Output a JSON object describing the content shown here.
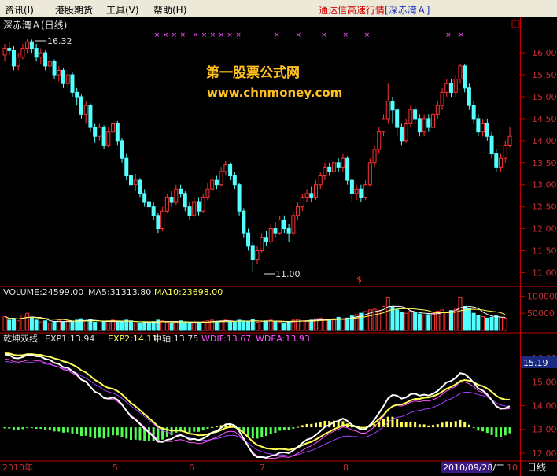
{
  "menu": [
    {
      "label": "资讯(I)"
    },
    {
      "label": "港股期货"
    },
    {
      "label": "工具(V)"
    },
    {
      "label": "帮助(H)"
    }
  ],
  "app_title": {
    "name": "通达信高速行情",
    "stock": "[深赤湾Ａ]"
  },
  "main_panel": {
    "title": "深赤湾Ａ(日线)",
    "watermark_line1": "第一股票公式网",
    "watermark_line2": "www.chnmoney.com",
    "high_label": "16.32",
    "low_label": "11.00",
    "signal_mark": "$"
  },
  "volume_panel": {
    "volume": "VOLUME:24599.00",
    "ma5": "MA5:31313.80",
    "ma10": "MA10:23698.00"
  },
  "indicator_panel": {
    "name": "乾坤双线",
    "exp1": "EXP1:13.94",
    "exp2": "EXP2:14.11",
    "mid": "中轴:13.75",
    "wdif": "WDIF:13.67",
    "wdea": "WDEA:13.93",
    "current_value": "15.19"
  },
  "axes": {
    "price_ticks": [
      "16.00",
      "15.50",
      "15.00",
      "14.50",
      "14.00",
      "13.50",
      "13.00",
      "12.50",
      "12.00",
      "11.50",
      "11.00"
    ],
    "volume_ticks": [
      "100000",
      "50000"
    ],
    "indicator_ticks": [
      "16.00",
      "15.00",
      "14.00",
      "13.00",
      "12.00"
    ],
    "x_labels": [
      "2010年",
      "5",
      "6",
      "7",
      "8"
    ],
    "cursor_date": "2010/09/28/二",
    "x_last": "10",
    "period": "日线"
  },
  "colors": {
    "up": "#ff3232",
    "down": "#54ffff",
    "exp1": "#ffff54",
    "exp2": "#ffffff",
    "wdif": "#ff54ff",
    "wdea": "#a040ff",
    "hist_up": "#ffff54",
    "hist_down": "#54ff54",
    "axis": "#c00000"
  },
  "chart_data": {
    "type": "candlestick",
    "price_range": [
      10.9,
      16.45
    ],
    "candles": [
      [
        15.95,
        16.1,
        16.2,
        15.8
      ],
      [
        16.1,
        16.05,
        16.25,
        15.95
      ],
      [
        16.05,
        15.7,
        16.15,
        15.6
      ],
      [
        15.7,
        15.9,
        16.0,
        15.6
      ],
      [
        15.9,
        16.1,
        16.2,
        15.85
      ],
      [
        16.1,
        16.25,
        16.32,
        16.0
      ],
      [
        16.25,
        16.1,
        16.3,
        16.0
      ],
      [
        16.1,
        15.9,
        16.2,
        15.8
      ],
      [
        15.9,
        16.0,
        16.1,
        15.75
      ],
      [
        16.0,
        15.7,
        16.05,
        15.6
      ],
      [
        15.7,
        15.8,
        15.9,
        15.55
      ],
      [
        15.8,
        15.5,
        15.85,
        15.4
      ],
      [
        15.5,
        15.6,
        15.7,
        15.35
      ],
      [
        15.6,
        15.3,
        15.65,
        15.2
      ],
      [
        15.3,
        15.5,
        15.6,
        15.2
      ],
      [
        15.5,
        15.1,
        15.55,
        15.0
      ],
      [
        15.1,
        15.0,
        15.2,
        14.8
      ],
      [
        15.0,
        14.6,
        15.05,
        14.5
      ],
      [
        14.6,
        14.8,
        14.9,
        14.4
      ],
      [
        14.8,
        14.3,
        14.85,
        14.2
      ],
      [
        14.3,
        14.1,
        14.4,
        13.95
      ],
      [
        14.1,
        14.3,
        14.4,
        14.0
      ],
      [
        14.3,
        13.9,
        14.35,
        13.8
      ],
      [
        13.9,
        14.2,
        14.3,
        13.85
      ],
      [
        14.2,
        14.4,
        14.5,
        14.1
      ],
      [
        14.4,
        14.0,
        14.45,
        13.9
      ],
      [
        14.0,
        13.6,
        14.05,
        13.5
      ],
      [
        13.6,
        13.2,
        13.7,
        13.1
      ],
      [
        13.2,
        13.0,
        13.3,
        12.9
      ],
      [
        13.0,
        13.1,
        13.25,
        12.85
      ],
      [
        13.1,
        12.8,
        13.15,
        12.7
      ],
      [
        12.8,
        12.6,
        12.9,
        12.5
      ],
      [
        12.6,
        12.5,
        12.7,
        12.3
      ],
      [
        12.5,
        12.3,
        12.6,
        12.2
      ],
      [
        12.3,
        12.0,
        12.35,
        11.9
      ],
      [
        12.0,
        12.4,
        12.5,
        11.95
      ],
      [
        12.4,
        12.7,
        12.8,
        12.35
      ],
      [
        12.7,
        12.6,
        12.85,
        12.5
      ],
      [
        12.6,
        12.9,
        13.0,
        12.55
      ],
      [
        12.9,
        12.8,
        13.0,
        12.7
      ],
      [
        12.8,
        12.5,
        12.85,
        12.4
      ],
      [
        12.5,
        12.3,
        12.6,
        12.2
      ],
      [
        12.3,
        12.6,
        12.7,
        12.25
      ],
      [
        12.6,
        12.4,
        12.7,
        12.3
      ],
      [
        12.4,
        12.7,
        12.8,
        12.35
      ],
      [
        12.7,
        12.9,
        13.05,
        12.65
      ],
      [
        12.9,
        13.1,
        13.2,
        12.85
      ],
      [
        13.1,
        13.0,
        13.2,
        12.9
      ],
      [
        13.0,
        13.3,
        13.4,
        12.95
      ],
      [
        13.3,
        13.45,
        13.55,
        13.2
      ],
      [
        13.45,
        13.2,
        13.5,
        13.1
      ],
      [
        13.2,
        13.0,
        13.3,
        12.9
      ],
      [
        13.0,
        12.4,
        13.05,
        12.3
      ],
      [
        12.4,
        11.9,
        12.45,
        11.8
      ],
      [
        11.9,
        11.6,
        12.0,
        11.5
      ],
      [
        11.6,
        11.3,
        11.7,
        11.0
      ],
      [
        11.3,
        11.5,
        11.6,
        11.2
      ],
      [
        11.5,
        11.8,
        11.9,
        11.45
      ],
      [
        11.8,
        11.7,
        11.95,
        11.6
      ],
      [
        11.7,
        12.0,
        12.1,
        11.65
      ],
      [
        12.0,
        11.9,
        12.15,
        11.8
      ],
      [
        11.9,
        12.2,
        12.3,
        11.85
      ],
      [
        12.2,
        12.0,
        12.3,
        11.9
      ],
      [
        12.0,
        11.9,
        12.1,
        11.7
      ],
      [
        11.9,
        12.3,
        12.4,
        11.85
      ],
      [
        12.3,
        12.5,
        12.6,
        12.2
      ],
      [
        12.5,
        12.7,
        12.8,
        12.4
      ],
      [
        12.7,
        12.8,
        12.9,
        12.6
      ],
      [
        12.8,
        12.7,
        12.95,
        12.6
      ],
      [
        12.7,
        13.0,
        13.1,
        12.65
      ],
      [
        13.0,
        13.2,
        13.3,
        12.9
      ],
      [
        13.2,
        13.4,
        13.5,
        13.1
      ],
      [
        13.4,
        13.3,
        13.5,
        13.2
      ],
      [
        13.3,
        13.5,
        13.6,
        13.2
      ],
      [
        13.5,
        13.4,
        13.6,
        13.3
      ],
      [
        13.4,
        13.6,
        13.7,
        13.3
      ],
      [
        13.6,
        13.1,
        13.65,
        13.0
      ],
      [
        13.1,
        12.8,
        13.15,
        12.6
      ],
      [
        12.8,
        12.9,
        13.0,
        12.65
      ],
      [
        12.9,
        12.7,
        13.0,
        12.6
      ],
      [
        12.7,
        13.0,
        13.1,
        12.65
      ],
      [
        13.0,
        13.5,
        13.6,
        12.95
      ],
      [
        13.5,
        13.8,
        13.9,
        13.4
      ],
      [
        13.8,
        14.2,
        14.3,
        13.7
      ],
      [
        14.2,
        14.5,
        14.6,
        14.1
      ],
      [
        14.5,
        14.9,
        15.3,
        14.4
      ],
      [
        14.9,
        14.7,
        15.0,
        14.4
      ],
      [
        14.7,
        14.3,
        14.75,
        14.1
      ],
      [
        14.3,
        14.0,
        14.4,
        13.9
      ],
      [
        14.0,
        14.4,
        14.5,
        13.95
      ],
      [
        14.4,
        14.7,
        14.8,
        14.3
      ],
      [
        14.7,
        14.5,
        14.8,
        14.4
      ],
      [
        14.5,
        14.2,
        14.6,
        14.1
      ],
      [
        14.2,
        14.5,
        14.6,
        14.1
      ],
      [
        14.5,
        14.3,
        14.6,
        14.2
      ],
      [
        14.3,
        14.6,
        14.7,
        14.2
      ],
      [
        14.6,
        14.8,
        14.9,
        14.5
      ],
      [
        14.8,
        15.1,
        15.2,
        14.7
      ],
      [
        15.1,
        15.3,
        15.4,
        15.0
      ],
      [
        15.3,
        15.1,
        15.4,
        15.0
      ],
      [
        15.1,
        15.4,
        15.5,
        15.0
      ],
      [
        15.4,
        15.7,
        15.75,
        15.3
      ],
      [
        15.7,
        15.2,
        15.75,
        15.1
      ],
      [
        15.2,
        14.8,
        15.3,
        14.7
      ],
      [
        14.8,
        14.5,
        14.9,
        14.4
      ],
      [
        14.5,
        14.2,
        14.6,
        14.1
      ],
      [
        14.2,
        14.4,
        14.5,
        14.1
      ],
      [
        14.4,
        14.1,
        14.5,
        14.0
      ],
      [
        14.1,
        13.7,
        14.2,
        13.6
      ],
      [
        13.7,
        13.4,
        13.8,
        13.3
      ],
      [
        13.4,
        13.6,
        13.7,
        13.3
      ],
      [
        13.6,
        13.9,
        14.0,
        13.5
      ],
      [
        13.9,
        14.1,
        14.3,
        13.85
      ]
    ],
    "volume": [
      40,
      30,
      35,
      28,
      45,
      50,
      38,
      30,
      25,
      28,
      22,
      26,
      30,
      24,
      28,
      26,
      30,
      34,
      28,
      32,
      24,
      22,
      26,
      28,
      30,
      24,
      26,
      30,
      28,
      22,
      20,
      24,
      22,
      26,
      30,
      28,
      24,
      22,
      26,
      28,
      24,
      20,
      22,
      24,
      26,
      28,
      30,
      26,
      28,
      30,
      26,
      24,
      30,
      28,
      26,
      32,
      24,
      26,
      28,
      30,
      26,
      24,
      22,
      26,
      30,
      32,
      28,
      26,
      30,
      34,
      36,
      32,
      30,
      34,
      38,
      34,
      36,
      42,
      46,
      50,
      55,
      60,
      62,
      58,
      70,
      95,
      68,
      60,
      54,
      50,
      56,
      52,
      48,
      44,
      46,
      50,
      56,
      60,
      54,
      58,
      62,
      95,
      70,
      64,
      50,
      44,
      40,
      36,
      38,
      42,
      38,
      36
    ]
  }
}
